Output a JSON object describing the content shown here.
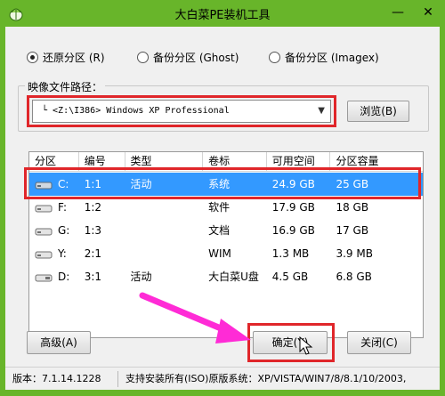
{
  "window": {
    "title": "大白菜PE装机工具",
    "controls": {
      "minimize": "—",
      "close": "✕"
    },
    "frame_color": "#68b52a"
  },
  "modes": [
    {
      "label": "还原分区 (R)",
      "selected": true
    },
    {
      "label": "备份分区 (Ghost)",
      "selected": false
    },
    {
      "label": "备份分区 (Imagex)",
      "selected": false
    }
  ],
  "image_path": {
    "group_label": "映像文件路径：",
    "value": "└ <Z:\\I386> Windows XP Professional",
    "browse_label": "浏览(B)"
  },
  "table": {
    "columns": [
      "分区",
      "编号",
      "类型",
      "卷标",
      "可用空间",
      "分区容量"
    ],
    "rows": [
      {
        "drive": "C:",
        "number": "1:1",
        "type": "活动",
        "label": "系统",
        "free": "24.9 GB",
        "capacity": "25 GB",
        "selected": true
      },
      {
        "drive": "F:",
        "number": "1:2",
        "type": "",
        "label": "软件",
        "free": "17.9 GB",
        "capacity": "18 GB",
        "selected": false
      },
      {
        "drive": "G:",
        "number": "1:3",
        "type": "",
        "label": "文档",
        "free": "16.9 GB",
        "capacity": "17 GB",
        "selected": false
      },
      {
        "drive": "Y:",
        "number": "2:1",
        "type": "",
        "label": "WIM",
        "free": "1.3 MB",
        "capacity": "3.9 MB",
        "selected": false
      },
      {
        "drive": "D:",
        "number": "3:1",
        "type": "活动",
        "label": "大白菜U盘",
        "free": "4.5 GB",
        "capacity": "6.8 GB",
        "selected": false
      }
    ],
    "selection_color": "#3399ff"
  },
  "buttons": {
    "advanced": "高级(A)",
    "ok": "确定(Y)",
    "close": "关闭(C)"
  },
  "status": {
    "version": "版本：7.1.14.1228",
    "support": "支持安装所有(ISO)原版系统：XP/VISTA/WIN7/8/8.1/10/2003,"
  },
  "annotation_color": "#e0262a",
  "arrow_color": "#ff2bd6"
}
